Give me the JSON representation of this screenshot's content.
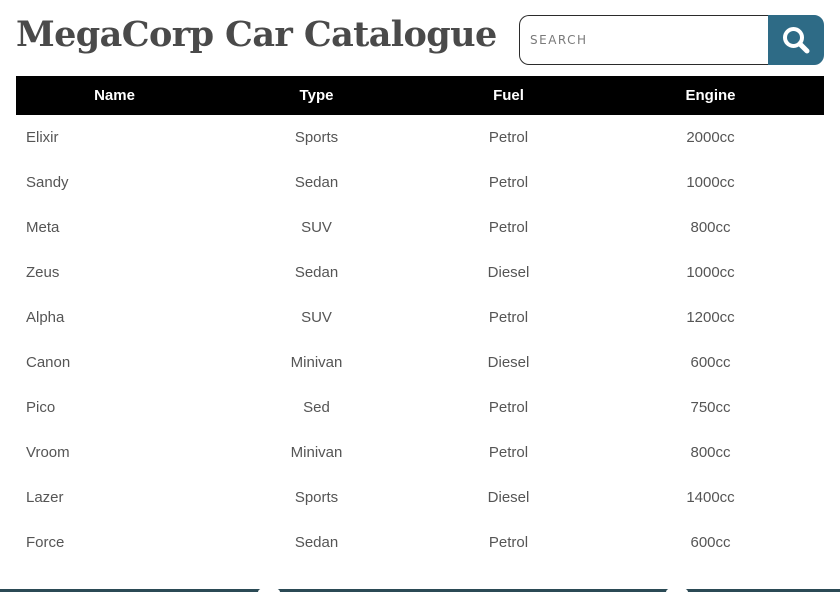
{
  "header": {
    "title": "MegaCorp Car Catalogue",
    "search": {
      "placeholder": "SEARCH",
      "value": ""
    },
    "search_button_icon": "search-icon"
  },
  "table": {
    "columns": [
      "Name",
      "Type",
      "Fuel",
      "Engine"
    ],
    "rows": [
      [
        "Elixir",
        "Sports",
        "Petrol",
        "2000cc"
      ],
      [
        "Sandy",
        "Sedan",
        "Petrol",
        "1000cc"
      ],
      [
        "Meta",
        "SUV",
        "Petrol",
        "800cc"
      ],
      [
        "Zeus",
        "Sedan",
        "Diesel",
        "1000cc"
      ],
      [
        "Alpha",
        "SUV",
        "Petrol",
        "1200cc"
      ],
      [
        "Canon",
        "Minivan",
        "Diesel",
        "600cc"
      ],
      [
        "Pico",
        "Sed",
        "Petrol",
        "750cc"
      ],
      [
        "Vroom",
        "Minivan",
        "Petrol",
        "800cc"
      ],
      [
        "Lazer",
        "Sports",
        "Diesel",
        "1400cc"
      ],
      [
        "Force",
        "Sedan",
        "Petrol",
        "600cc"
      ]
    ]
  },
  "colors": {
    "title": "#4a4a4a",
    "search_button": "#2e6b86",
    "table_header_bg": "#000000",
    "table_header_text": "#ffffff",
    "cell_text": "#555555",
    "footer": "#2b4a55"
  }
}
